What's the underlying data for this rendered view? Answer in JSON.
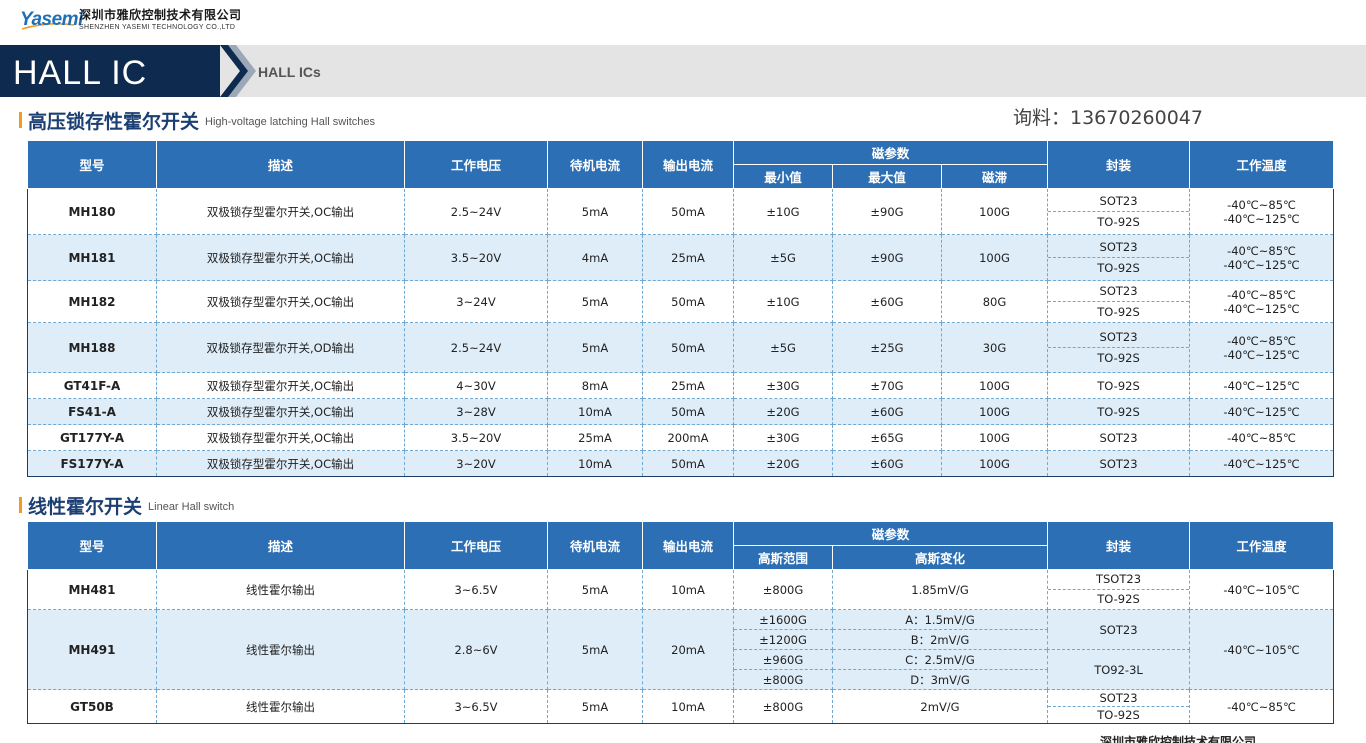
{
  "header": {
    "logo_text": "Yasemi",
    "company_cn": "深圳市雅欣控制技术有限公司",
    "company_en": "SHENZHEN YASEMI TECHNOLOGY CO.,LTD"
  },
  "banner": {
    "title": "HALL IC",
    "subtitle": "HALL ICs"
  },
  "contact": "询料：13670260047",
  "section1": {
    "title_cn": "高压锁存性霍尔开关",
    "title_en": "High-voltage latching Hall switches",
    "headers": {
      "model": "型号",
      "desc": "描述",
      "voltage": "工作电压",
      "standby": "待机电流",
      "output": "输出电流",
      "magnetic": "磁参数",
      "min": "最小值",
      "max": "最大值",
      "hyst": "磁滞",
      "package": "封装",
      "temp": "工作温度"
    },
    "rows": [
      {
        "model": "MH180",
        "desc": "双极锁存型霍尔开关,OC输出",
        "voltage": "2.5~24V",
        "standby": "5mA",
        "output": "50mA",
        "min": "±10G",
        "max": "±90G",
        "hyst": "100G",
        "pkg1": "SOT23",
        "pkg2": "TO-92S",
        "temp1": "-40℃~85℃",
        "temp2": "-40℃~125℃"
      },
      {
        "model": "MH181",
        "desc": "双极锁存型霍尔开关,OC输出",
        "voltage": "3.5~20V",
        "standby": "4mA",
        "output": "25mA",
        "min": "±5G",
        "max": "±90G",
        "hyst": "100G",
        "pkg1": "SOT23",
        "pkg2": "TO-92S",
        "temp1": "-40℃~85℃",
        "temp2": "-40℃~125℃"
      },
      {
        "model": "MH182",
        "desc": "双极锁存型霍尔开关,OC输出",
        "voltage": "3~24V",
        "standby": "5mA",
        "output": "50mA",
        "min": "±10G",
        "max": "±60G",
        "hyst": "80G",
        "pkg1": "SOT23",
        "pkg2": "TO-92S",
        "temp1": "-40℃~85℃",
        "temp2": "-40℃~125℃"
      },
      {
        "model": "MH188",
        "desc": "双极锁存型霍尔开关,OD输出",
        "voltage": "2.5~24V",
        "standby": "5mA",
        "output": "50mA",
        "min": "±5G",
        "max": "±25G",
        "hyst": "30G",
        "pkg1": "SOT23",
        "pkg2": "TO-92S",
        "temp1": "-40℃~85℃",
        "temp2": "-40℃~125℃"
      },
      {
        "model": "GT41F-A",
        "desc": "双极锁存型霍尔开关,OC输出",
        "voltage": "4~30V",
        "standby": "8mA",
        "output": "25mA",
        "min": "±30G",
        "max": "±70G",
        "hyst": "100G",
        "pkg1": "TO-92S",
        "temp1": "-40℃~125℃"
      },
      {
        "model": "FS41-A",
        "desc": "双极锁存型霍尔开关,OC输出",
        "voltage": "3~28V",
        "standby": "10mA",
        "output": "50mA",
        "min": "±20G",
        "max": "±60G",
        "hyst": "100G",
        "pkg1": "TO-92S",
        "temp1": "-40℃~125℃"
      },
      {
        "model": "GT177Y-A",
        "desc": "双极锁存型霍尔开关,OC输出",
        "voltage": "3.5~20V",
        "standby": "25mA",
        "output": "200mA",
        "min": "±30G",
        "max": "±65G",
        "hyst": "100G",
        "pkg1": "SOT23",
        "temp1": "-40℃~85℃"
      },
      {
        "model": "FS177Y-A",
        "desc": "双极锁存型霍尔开关,OC输出",
        "voltage": "3~20V",
        "standby": "10mA",
        "output": "50mA",
        "min": "±20G",
        "max": "±60G",
        "hyst": "100G",
        "pkg1": "SOT23",
        "temp1": "-40℃~125℃"
      }
    ]
  },
  "section2": {
    "title_cn": "线性霍尔开关",
    "title_en": "Linear Hall switch",
    "headers": {
      "model": "型号",
      "desc": "描述",
      "voltage": "工作电压",
      "standby": "待机电流",
      "output": "输出电流",
      "magnetic": "磁参数",
      "range": "高斯范围",
      "change": "高斯变化",
      "package": "封装",
      "temp": "工作温度"
    },
    "rows": [
      {
        "model": "MH481",
        "desc": "线性霍尔输出",
        "voltage": "3~6.5V",
        "standby": "5mA",
        "output": "10mA",
        "range": "±800G",
        "change": "1.85mV/G",
        "pkg1": "TSOT23",
        "pkg2": "TO-92S",
        "temp": "-40℃~105℃"
      },
      {
        "model": "MH491",
        "desc": "线性霍尔输出",
        "voltage": "2.8~6V",
        "standby": "5mA",
        "output": "20mA",
        "ranges": [
          "±1600G",
          "±1200G",
          "±960G",
          "±800G"
        ],
        "changes": [
          "A：1.5mV/G",
          "B：2mV/G",
          "C：2.5mV/G",
          "D：3mV/G"
        ],
        "pkg1": "SOT23",
        "pkg2": "TO92-3L",
        "temp": "-40℃~105℃"
      },
      {
        "model": "GT50B",
        "desc": "线性霍尔输出",
        "voltage": "3~6.5V",
        "standby": "5mA",
        "output": "10mA",
        "range": "±800G",
        "change": "2mV/G",
        "pkg1": "SOT23",
        "pkg2": "TO-92S",
        "temp": "-40℃~85℃"
      }
    ]
  },
  "footer_company": "深圳市雅欣控制技术有限公司",
  "colors": {
    "header_blue": "#2d6fb4",
    "row_alt": "#deedf8",
    "banner_dark": "#0e2a4f",
    "accent_orange": "#f29b1d"
  }
}
